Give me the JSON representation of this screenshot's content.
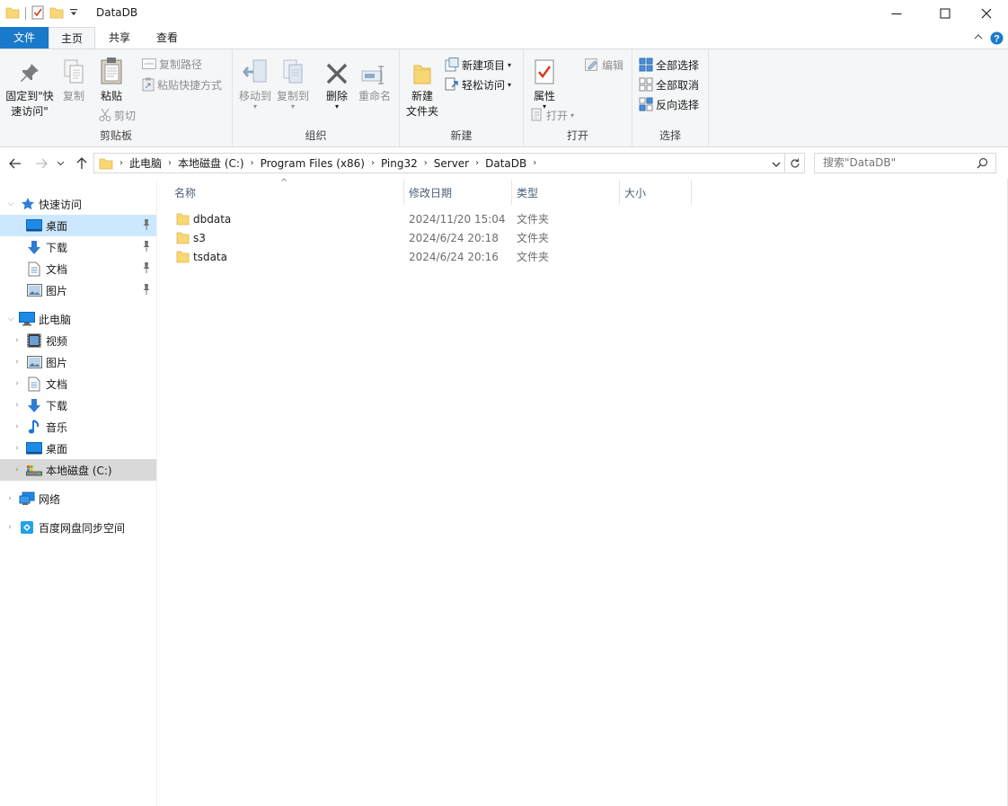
{
  "window": {
    "title": "DataDB",
    "minimize_glyph": "—",
    "maximize_glyph": "☐",
    "close_glyph": "✕"
  },
  "tabs": {
    "file": "文件",
    "home": "主页",
    "share": "共享",
    "view": "查看"
  },
  "ribbon": {
    "clipboard": {
      "label": "剪贴板",
      "pin_line1": "固定到\"快",
      "pin_line2": "速访问\"",
      "copy": "复制",
      "paste": "粘贴",
      "copy_path": "复制路径",
      "paste_shortcut": "粘贴快捷方式",
      "cut": "剪切"
    },
    "organize": {
      "label": "组织",
      "move_to": "移动到",
      "copy_to": "复制到",
      "delete": "删除",
      "rename": "重命名"
    },
    "new": {
      "label": "新建",
      "new_folder_line1": "新建",
      "new_folder_line2": "文件夹",
      "new_item": "新建项目",
      "easy_access": "轻松访问"
    },
    "open": {
      "label": "打开",
      "properties": "属性",
      "open": "打开",
      "edit": "编辑"
    },
    "select": {
      "label": "选择",
      "select_all": "全部选择",
      "select_none": "全部取消",
      "invert": "反向选择"
    }
  },
  "address": {
    "crumbs": [
      "此电脑",
      "本地磁盘 (C:)",
      "Program Files (x86)",
      "Ping32",
      "Server",
      "DataDB"
    ],
    "search_placeholder": "搜索\"DataDB\""
  },
  "nav": {
    "quick_access": "快速访问",
    "qa_items": [
      "桌面",
      "下载",
      "文档",
      "图片"
    ],
    "this_pc": "此电脑",
    "pc_items": [
      "视频",
      "图片",
      "文档",
      "下载",
      "音乐",
      "桌面",
      "本地磁盘 (C:)"
    ],
    "network": "网络",
    "baidu": "百度网盘同步空间"
  },
  "columns": {
    "name": "名称",
    "date": "修改日期",
    "type": "类型",
    "size": "大小"
  },
  "files": [
    {
      "name": "dbdata",
      "date": "2024/11/20 15:04",
      "type": "文件夹"
    },
    {
      "name": "s3",
      "date": "2024/6/24 20:18",
      "type": "文件夹"
    },
    {
      "name": "tsdata",
      "date": "2024/6/24 20:16",
      "type": "文件夹"
    }
  ],
  "colors": {
    "accent": "#1979ca",
    "selected": "#cce8ff",
    "folder": "#f8d775"
  }
}
